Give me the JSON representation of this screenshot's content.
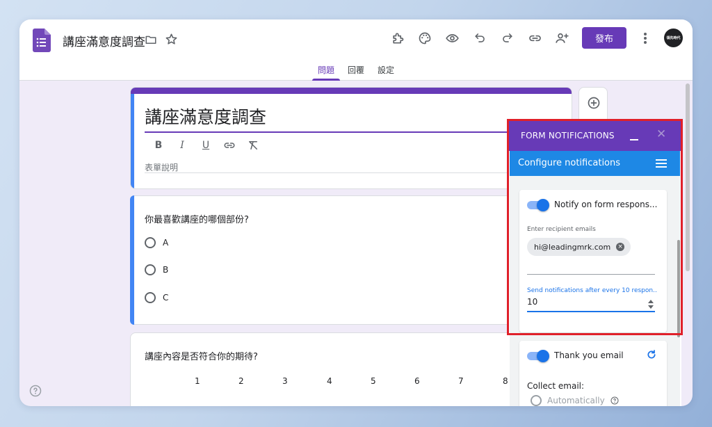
{
  "header": {
    "doc_title": "講座滿意度調查",
    "publish_label": "發布",
    "avatar_text": "領先時代"
  },
  "tabs": [
    {
      "label": "問題",
      "active": true
    },
    {
      "label": "回覆",
      "active": false
    },
    {
      "label": "設定",
      "active": false
    }
  ],
  "form": {
    "title": "講座滿意度調查",
    "description_placeholder": "表單說明",
    "questions": [
      {
        "text": "你最喜歡講座的哪個部份?",
        "options": [
          "A",
          "B",
          "C"
        ]
      },
      {
        "text": "講座內容是否符合你的期待?",
        "scale": [
          "1",
          "2",
          "3",
          "4",
          "5",
          "6",
          "7",
          "8"
        ]
      }
    ]
  },
  "addon": {
    "header_title": "FORM NOTIFICATIONS",
    "close_glyph": "✕",
    "bar_title": "Configure notifications",
    "notify_label": "Notify on form respons...",
    "notify_enabled": true,
    "recipient_label": "Enter recipient emails",
    "recipient_email": "hi@leadingmrk.com",
    "chip_remove_glyph": "×",
    "send_label": "Send notifications after every 10 respon...",
    "send_value": "10",
    "thankyou_label": "Thank you email",
    "thankyou_enabled": true,
    "collect_label": "Collect email:",
    "collect_option": "Automatically"
  },
  "colors": {
    "brand_purple": "#673ab7",
    "accent_blue": "#1e88e5",
    "highlight_red": "#e0202a"
  }
}
